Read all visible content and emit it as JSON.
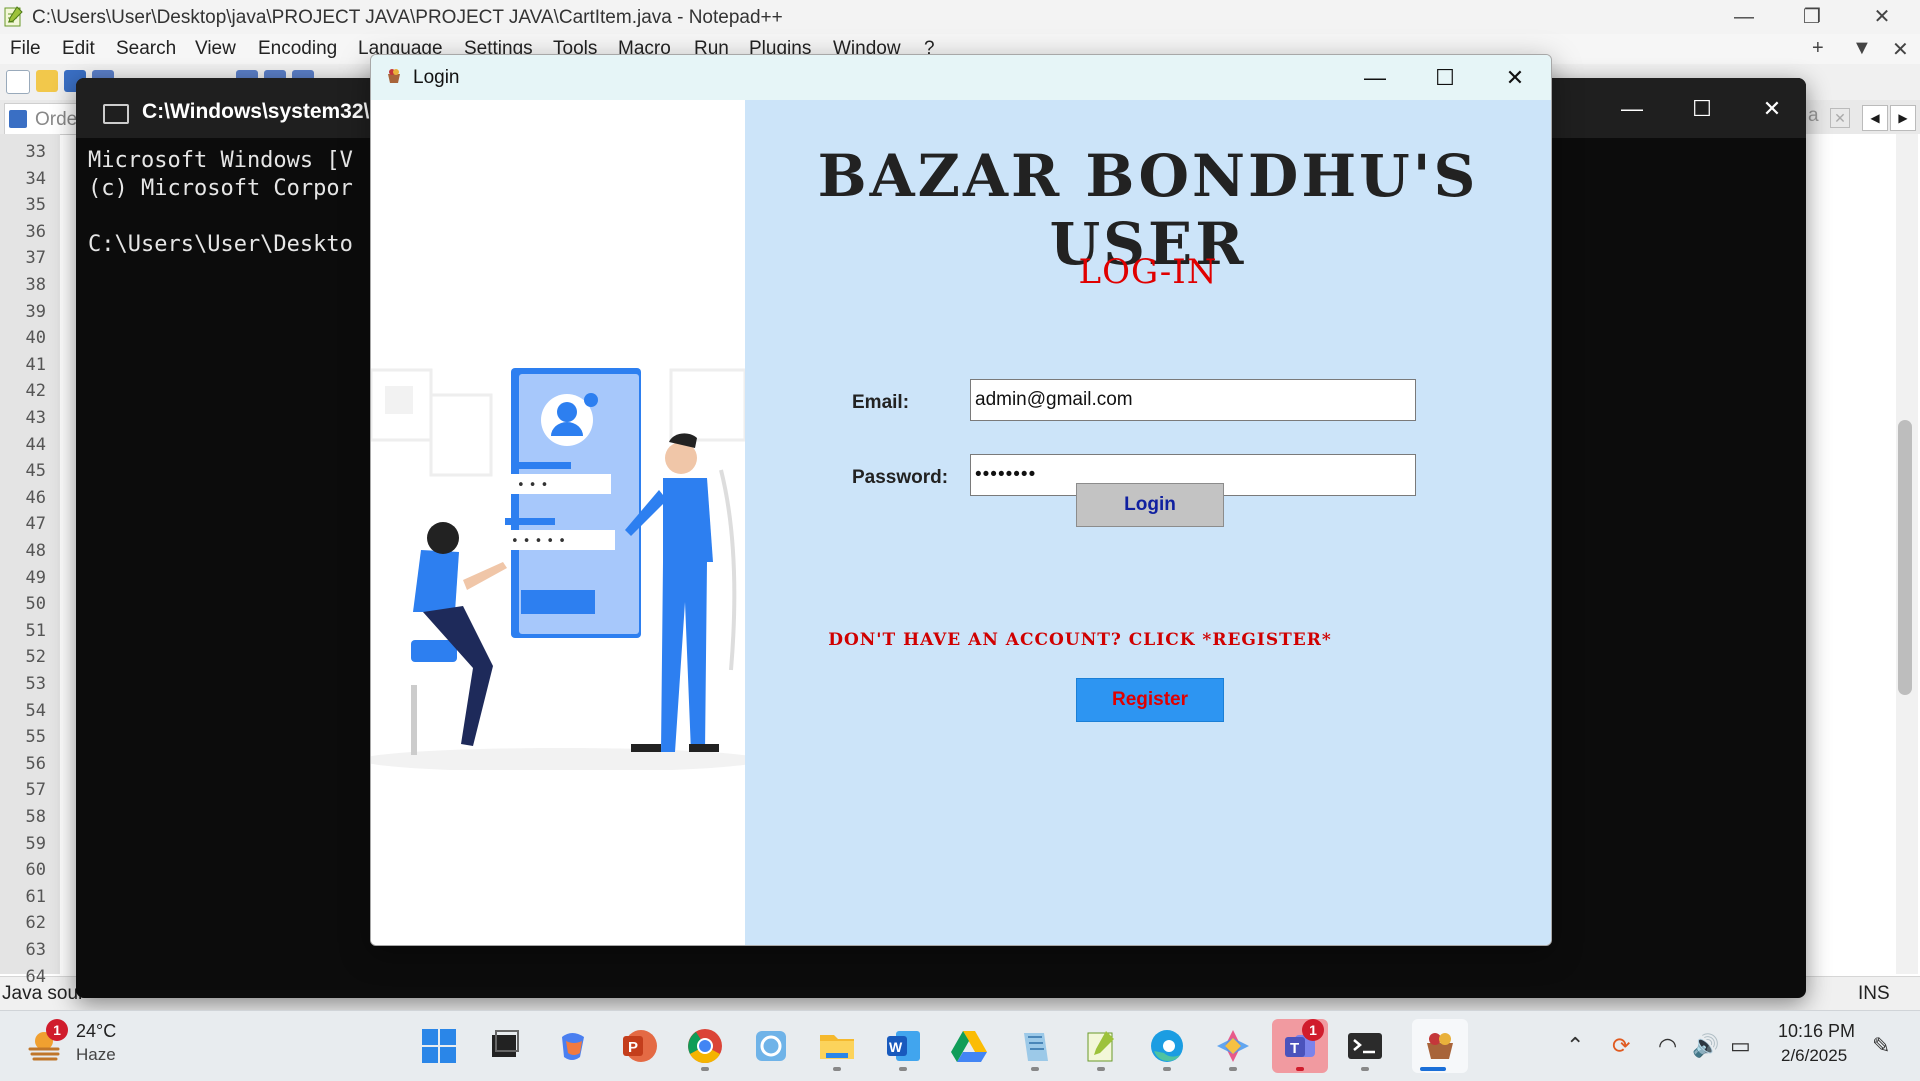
{
  "notepad": {
    "title": "C:\\Users\\User\\Desktop\\java\\PROJECT JAVA\\PROJECT JAVA\\CartItem.java - Notepad++",
    "menu": [
      "File",
      "Edit",
      "Search",
      "View",
      "Encoding",
      "Language",
      "Settings",
      "Tools",
      "Macro",
      "Run",
      "Plugins",
      "Window",
      "?"
    ],
    "tab_label": "Orde",
    "right_tab_label": "a",
    "line_numbers": [
      "33",
      "34",
      "35",
      "36",
      "37",
      "38",
      "39",
      "40",
      "41",
      "42",
      "43",
      "44",
      "45",
      "46",
      "47",
      "48",
      "49",
      "50",
      "51",
      "52",
      "53",
      "54",
      "55",
      "56",
      "57",
      "58",
      "59",
      "60",
      "61",
      "62",
      "63",
      "64"
    ],
    "status_left": "Java sour",
    "status_right": "INS"
  },
  "cmd": {
    "title": "C:\\Windows\\system32\\c",
    "lines": [
      "Microsoft Windows [V",
      "(c) Microsoft Corpor",
      "",
      "C:\\Users\\User\\Deskto"
    ]
  },
  "login": {
    "window_title": "Login",
    "app_title": "BAZAR BONDHU'S USER",
    "subtitle": "LOG-IN",
    "email_label": "Email:",
    "email_value": "admin@gmail.com",
    "password_label": "Password:",
    "password_value": "••••••••",
    "login_button": "Login",
    "no_account_text": "DON'T HAVE AN ACCOUNT? CLICK *REGISTER*",
    "register_button": "Register",
    "illustration": {
      "field1_dots": "• • •",
      "field2_dots": "• • • • •"
    }
  },
  "taskbar": {
    "weather_temp": "24°C",
    "weather_desc": "Haze",
    "weather_badge": "1",
    "teams_badge": "1",
    "time": "10:16 PM",
    "date": "2/6/2025",
    "apps": [
      "start-icon",
      "task-view-icon",
      "copilot-icon",
      "powerpoint-icon",
      "chrome-icon",
      "photos-icon",
      "file-explorer-icon",
      "word-icon",
      "google-drive-icon",
      "notepad-icon",
      "notepadpp-icon",
      "edge-icon",
      "gemini-icon",
      "teams-icon",
      "terminal-icon",
      "java-app-icon"
    ]
  },
  "colors": {
    "login_panel_bg": "#cce4f9",
    "title_red": "#e00000",
    "register_blue": "#2d95f2",
    "cmd_bg": "#0c0c0c"
  }
}
